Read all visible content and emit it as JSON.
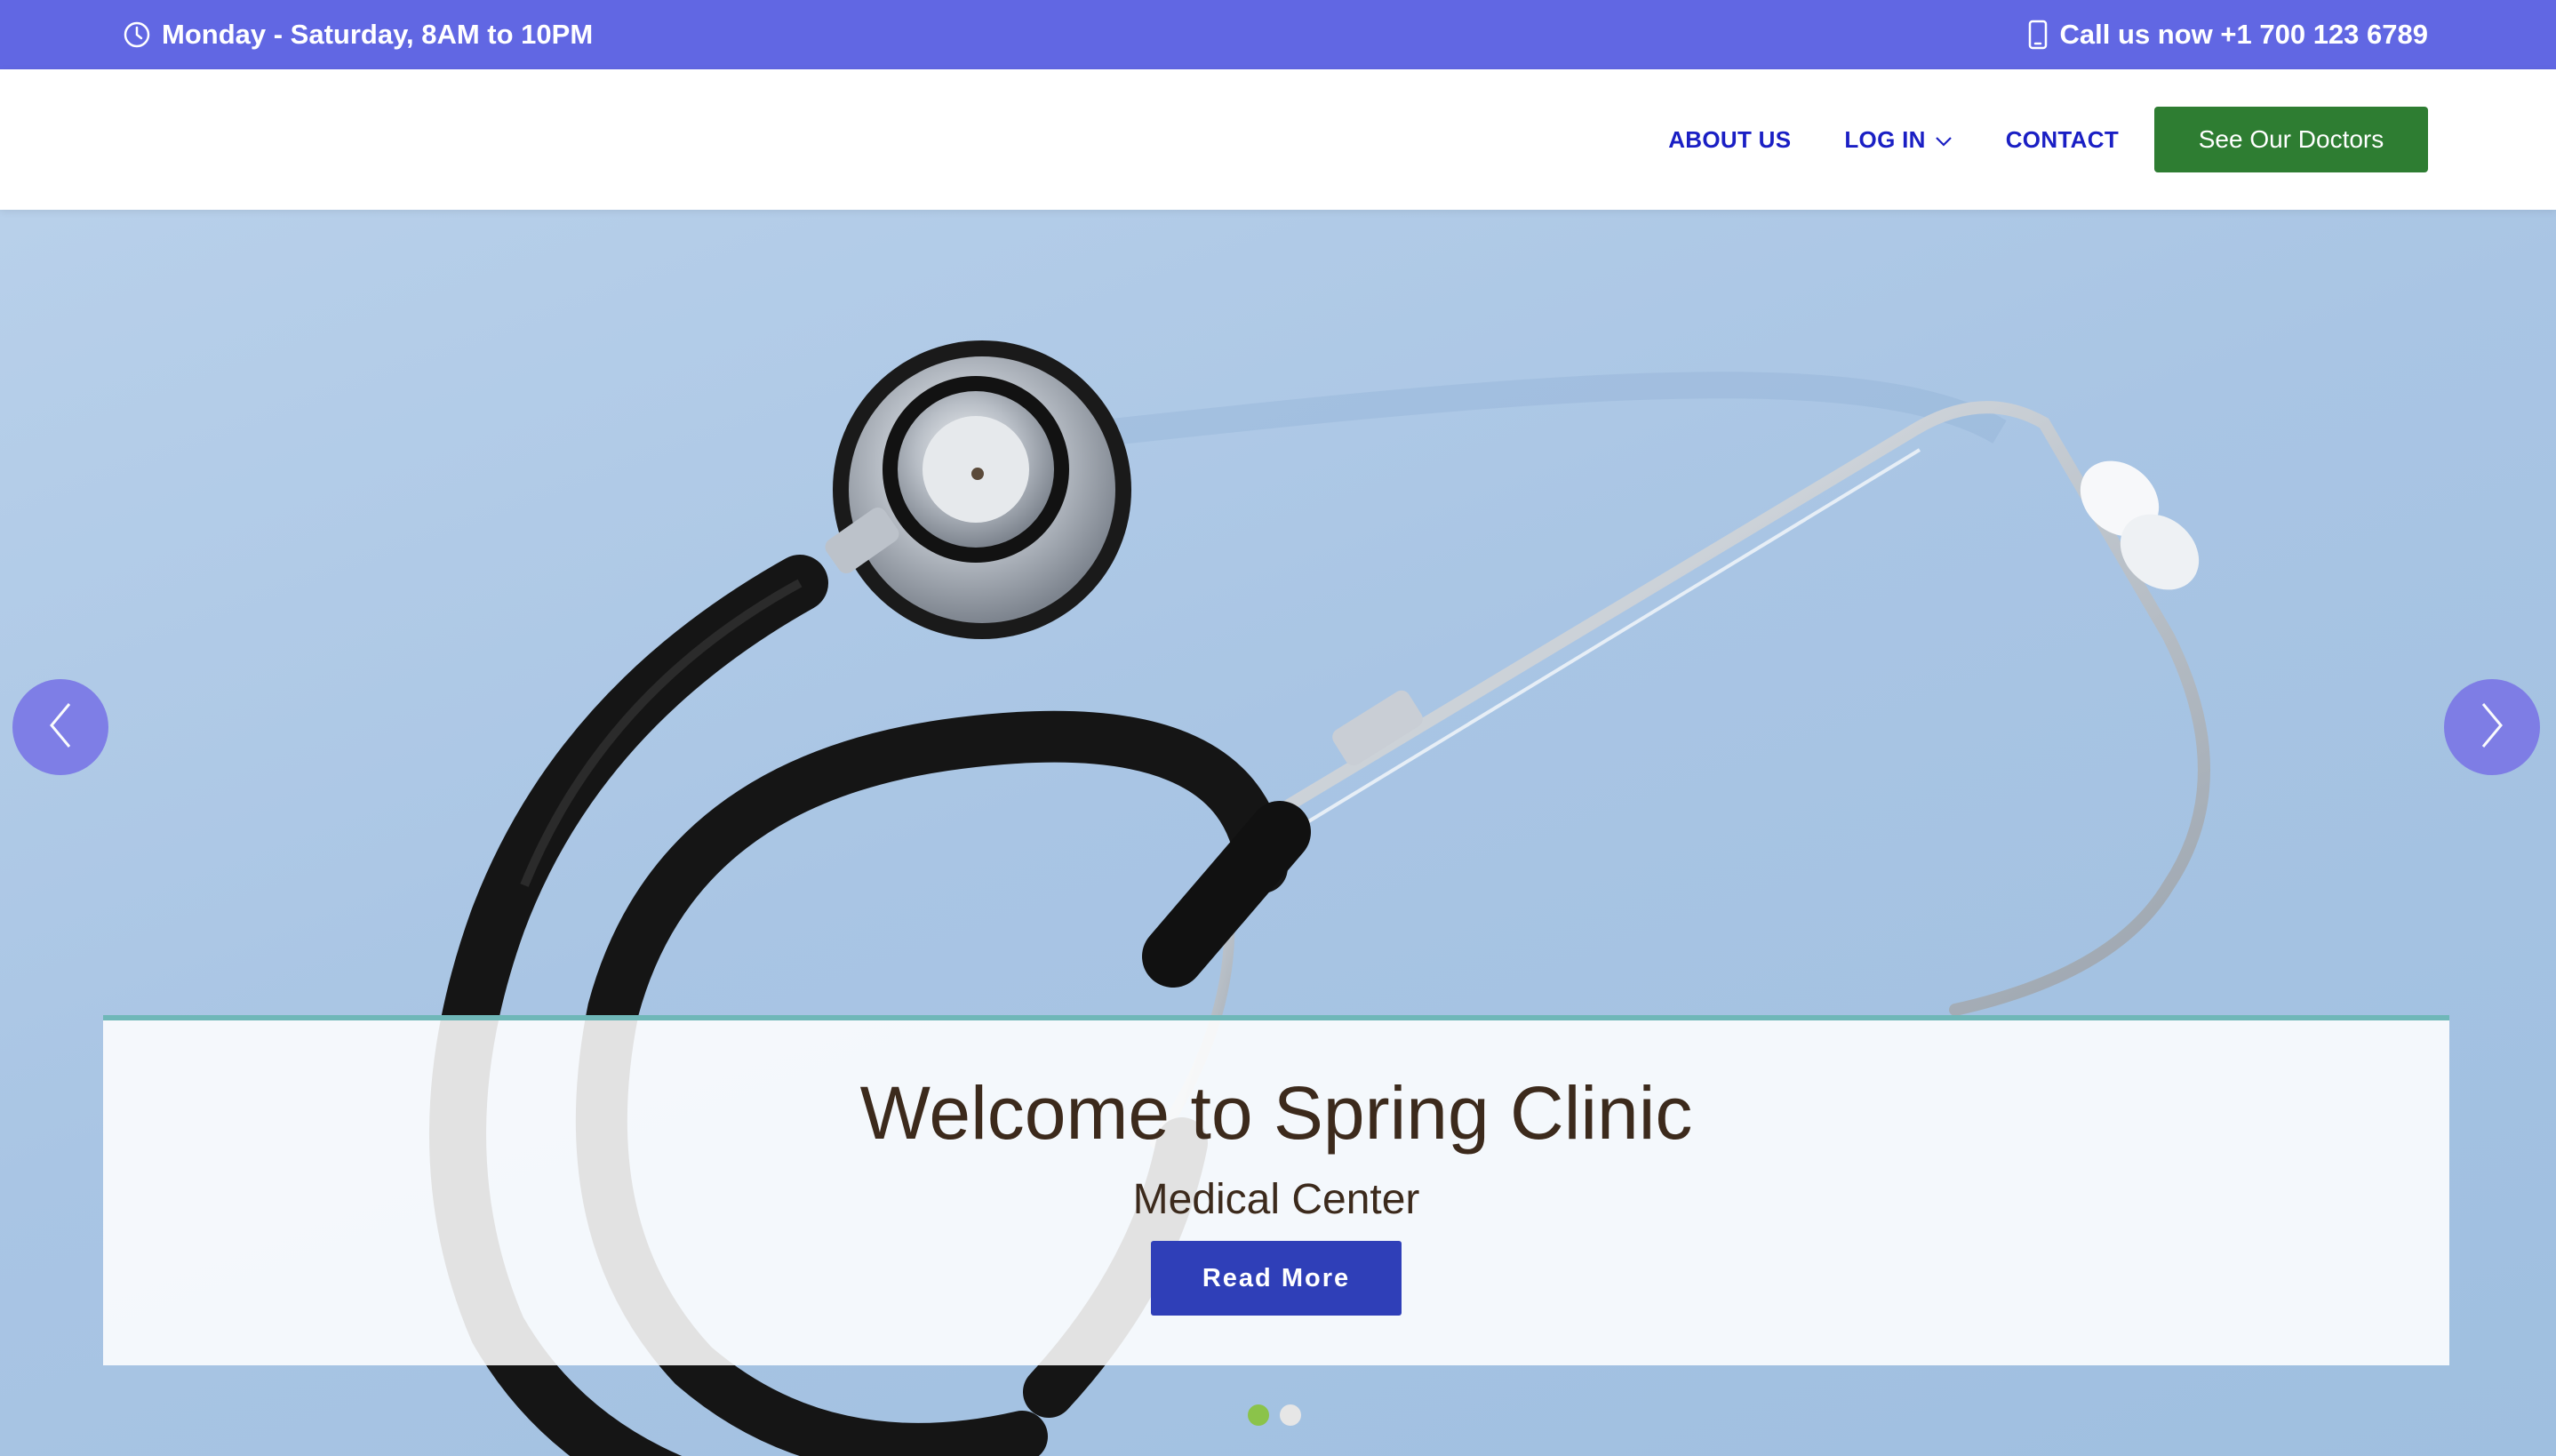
{
  "topbar": {
    "hours_icon": "clock-icon",
    "hours_text": "Monday - Saturday, 8AM to 10PM",
    "phone_icon": "mobile-phone-icon",
    "phone_text": "Call us now +1 700 123 6789"
  },
  "nav": {
    "items": [
      {
        "label": "ABOUT US"
      },
      {
        "label": "LOG IN",
        "icon": "chevron-down-icon"
      },
      {
        "label": "CONTACT"
      }
    ],
    "cta_label": "See Our Doctors"
  },
  "hero": {
    "image": "stethoscope-photo",
    "title": "Welcome to Spring Clinic",
    "subtitle": "Medical Center",
    "button_label": "Read More",
    "prev_icon": "chevron-left-icon",
    "next_icon": "chevron-right-icon",
    "slides": 2,
    "active_slide": 1
  },
  "colors": {
    "topbar": "#6167e3",
    "nav_link": "#1a1fc4",
    "cta": "#2e7d32",
    "read_more": "#2f3fb8",
    "heading": "#3c2a1c",
    "caption_border": "#6fb7b8",
    "arrow": "#7c7ae6",
    "dot_active": "#8bc34a",
    "dot_inactive": "#e6e6e6"
  }
}
